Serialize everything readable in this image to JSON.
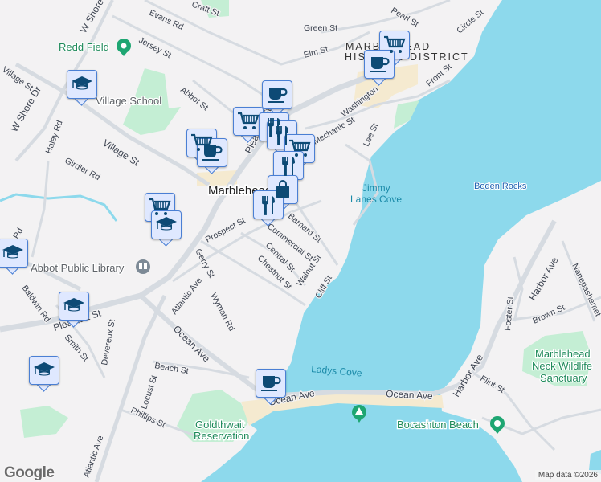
{
  "map": {
    "colors": {
      "water": "#8dd9ec",
      "land": "#f3f2f3",
      "park": "#c4eed4",
      "sand": "#f5ead0",
      "road": "#d6dbe1",
      "marker_fill": "#dfe8ff",
      "marker_icon": "#0d4a75"
    },
    "labels": {
      "streets": [
        "Evans Rd",
        "Jersey St",
        "W Shore Dr",
        "W Shore Dr",
        "Village St",
        "Village St",
        "Abbot St",
        "Haley Rd",
        "Girdler Rd",
        "Prospect St",
        "Gerry St",
        "Baldwin Rd",
        "Pleasant St",
        "Smith St",
        "Devereux St",
        "Atlantic Ave",
        "Atlantic Ave",
        "Wyman Rd",
        "Ocean Ave",
        "Ocean Ave",
        "Ocean Ave",
        "Beach St",
        "Locust St",
        "Phillips St",
        "Central St",
        "Chestnut St",
        "Walnut St",
        "Cliff St",
        "Commercial St",
        "Barnard St",
        "Green St",
        "Elm St",
        "Pearl St",
        "Circle St",
        "Front St",
        "Washington",
        "Lee St",
        "Harbor Ave",
        "Harbor Ave",
        "Foster St",
        "Brown St",
        "Flint St",
        "Nanepashemet",
        "Pleasant St",
        "Craft St",
        "Mechanic St",
        "Rd"
      ],
      "town": "Marblehead",
      "district": [
        "MARBLEHEAD",
        "HISTORIC DISTRICT"
      ],
      "water": [
        "Jimmy",
        "Lanes Cove",
        "Ladys Cove",
        "Boden Rocks"
      ],
      "pois": {
        "redd_field": "Redd Field",
        "village_school": "Village School",
        "abbot_library": "Abbot Public Library",
        "goldthwait": [
          "Goldthwait",
          "Reservation"
        ],
        "bocashton": "Bocashton Beach",
        "sanctuary": [
          "Marblehead",
          "Neck Wildlife",
          "Sanctuary"
        ]
      }
    },
    "markers": [
      "cart",
      "coffee",
      "coffee",
      "cart",
      "fork-knife",
      "fork-knife",
      "cart",
      "coffee",
      "cart",
      "fork-knife",
      "bag",
      "fork-knife",
      "cart",
      "graduation-cap",
      "graduation-cap",
      "graduation-cap",
      "graduation-cap",
      "graduation-cap",
      "coffee"
    ],
    "google_logo": "Google",
    "attribution": "Map data ©2026"
  }
}
